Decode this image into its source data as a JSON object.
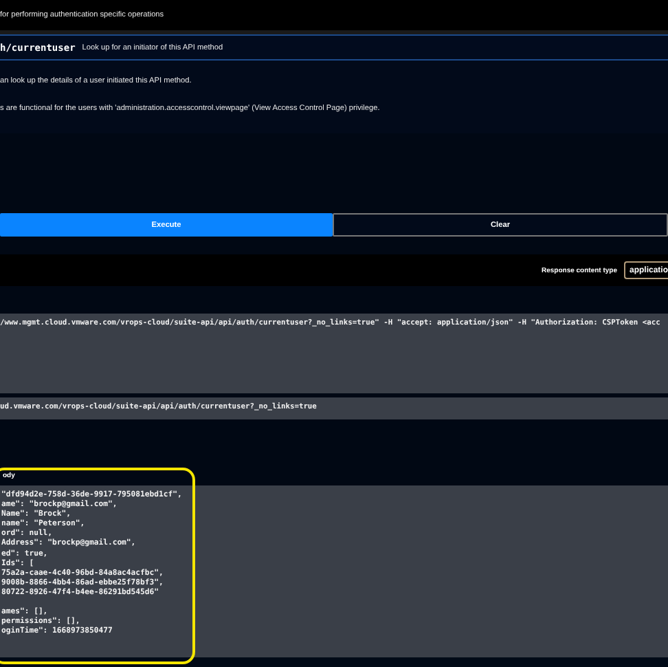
{
  "section_description": "for performing authentication specific operations",
  "operation": {
    "path": "h/currentuser",
    "summary": "Look up for an initiator of this API method",
    "expanded": true
  },
  "description_lines": [
    "an look up the details of a user initiated this API method.",
    "s are functional for the users with 'administration.accesscontrol.viewpage' (View Access Control Page) privilege."
  ],
  "buttons": [
    {
      "label": "Execute",
      "kind": "primary"
    },
    {
      "label": "Clear",
      "kind": "secondary"
    }
  ],
  "response_content_type": {
    "label": "Response content type",
    "value": "applicatio"
  },
  "curl": "/www.mgmt.cloud.vmware.com/vrops-cloud/suite-api/api/auth/currentuser?_no_links=true\" -H \"accept: application/json\" -H \"Authorization: CSPToken <acc",
  "request_url": "ud.vmware.com/vrops-cloud/suite-api/api/auth/currentuser?_no_links=true",
  "response_body": {
    "title": "ody",
    "highlighted": true,
    "blocks": [
      [
        "\"dfd94d2e-758d-36de-9917-795081ebd1cf\",",
        "ame\": \"brockp@gmail.com\",",
        "Name\": \"Brock\",",
        "name\": \"Peterson\",",
        "ord\": null,",
        "Address\": \"brockp@gmail.com\",",
        "ed\": true,",
        "Ids\": [",
        "75a2a-caae-4c40-96bd-84a8ac4acfbc\",",
        "9008b-8866-4bb4-86ad-ebbe25f78bf3\",",
        "80722-8926-47f4-b4ee-86291bd545d6\""
      ],
      [
        "ames\": [],",
        "permissions\": [],",
        "oginTime\": 1668973850477"
      ]
    ]
  }
}
